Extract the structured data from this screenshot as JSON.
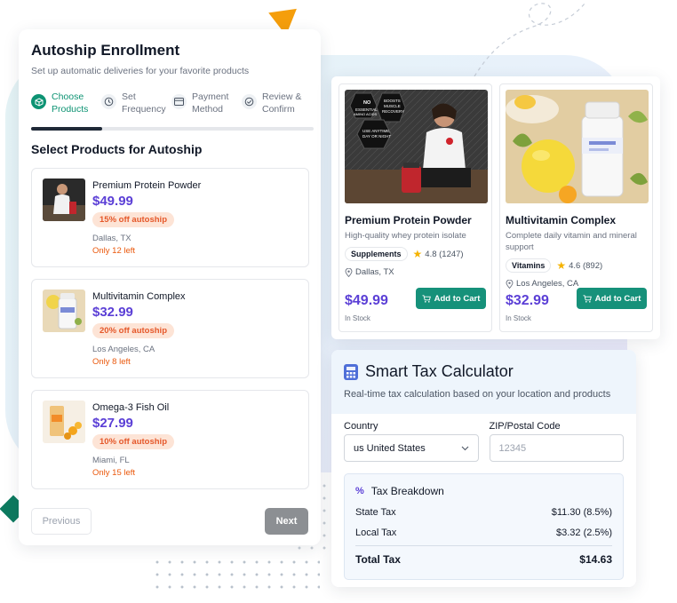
{
  "autoship": {
    "title": "Autoship Enrollment",
    "subtitle": "Set up automatic deliveries for your favorite products",
    "steps": [
      {
        "line1": "Choose",
        "line2": "Products",
        "icon": "box-icon",
        "active": true
      },
      {
        "line1": "Set",
        "line2": "Frequency",
        "icon": "clock-icon",
        "active": false
      },
      {
        "line1": "Payment",
        "line2": "Method",
        "icon": "card-icon",
        "active": false
      },
      {
        "line1": "Review &",
        "line2": "Confirm",
        "icon": "check-icon",
        "active": false
      }
    ],
    "progress_fraction": 0.25,
    "section_title": "Select Products for Autoship",
    "products": [
      {
        "name": "Premium Protein Powder",
        "price": "$49.99",
        "badge": "15% off autoship",
        "location": "Dallas, TX",
        "stock": "Only 12 left"
      },
      {
        "name": "Multivitamin Complex",
        "price": "$32.99",
        "badge": "20% off autoship",
        "location": "Los Angeles, CA",
        "stock": "Only 8 left"
      },
      {
        "name": "Omega-3 Fish Oil",
        "price": "$27.99",
        "badge": "10% off autoship",
        "location": "Miami, FL",
        "stock": "Only 15 left"
      }
    ],
    "prev_label": "Previous",
    "next_label": "Next"
  },
  "listing": {
    "cards": [
      {
        "name": "Premium Protein Powder",
        "desc": "High-quality whey protein isolate",
        "tag": "Supplements",
        "rating": "4.8 (1247)",
        "location": "Dallas, TX",
        "price": "$49.99",
        "stock": "In Stock",
        "cart_label": "Add to Cart"
      },
      {
        "name": "Multivitamin Complex",
        "desc": "Complete daily vitamin and mineral support",
        "tag": "Vitamins",
        "rating": "4.6 (892)",
        "location": "Los Angeles, CA",
        "price": "$32.99",
        "stock": "In Stock",
        "cart_label": "Add to Cart"
      }
    ],
    "image_text": [
      "NO",
      "ESSENTIAL",
      "AMINO ACIDS",
      "BOOSTS",
      "MUSCLE",
      "RECOVERY",
      "USE ANYTIME,",
      "DAY OR NIGHT"
    ]
  },
  "tax": {
    "title": "Smart Tax Calculator",
    "subtitle": "Real-time tax calculation based on your location and products",
    "country_label": "Country",
    "country_value": "us United States",
    "zip_label": "ZIP/Postal Code",
    "zip_placeholder": "12345",
    "breakdown_title": "Tax Breakdown",
    "rows": [
      {
        "label": "State Tax",
        "value": "$11.30 (8.5%)"
      },
      {
        "label": "Local Tax",
        "value": "$3.32 (2.5%)"
      }
    ],
    "total_label": "Total Tax",
    "total_value": "$14.63"
  },
  "colors": {
    "accent_green": "#0d9373",
    "price_purple": "#5b3fd6",
    "badge_orange": "#e5582a",
    "cart_green": "#16917a"
  }
}
